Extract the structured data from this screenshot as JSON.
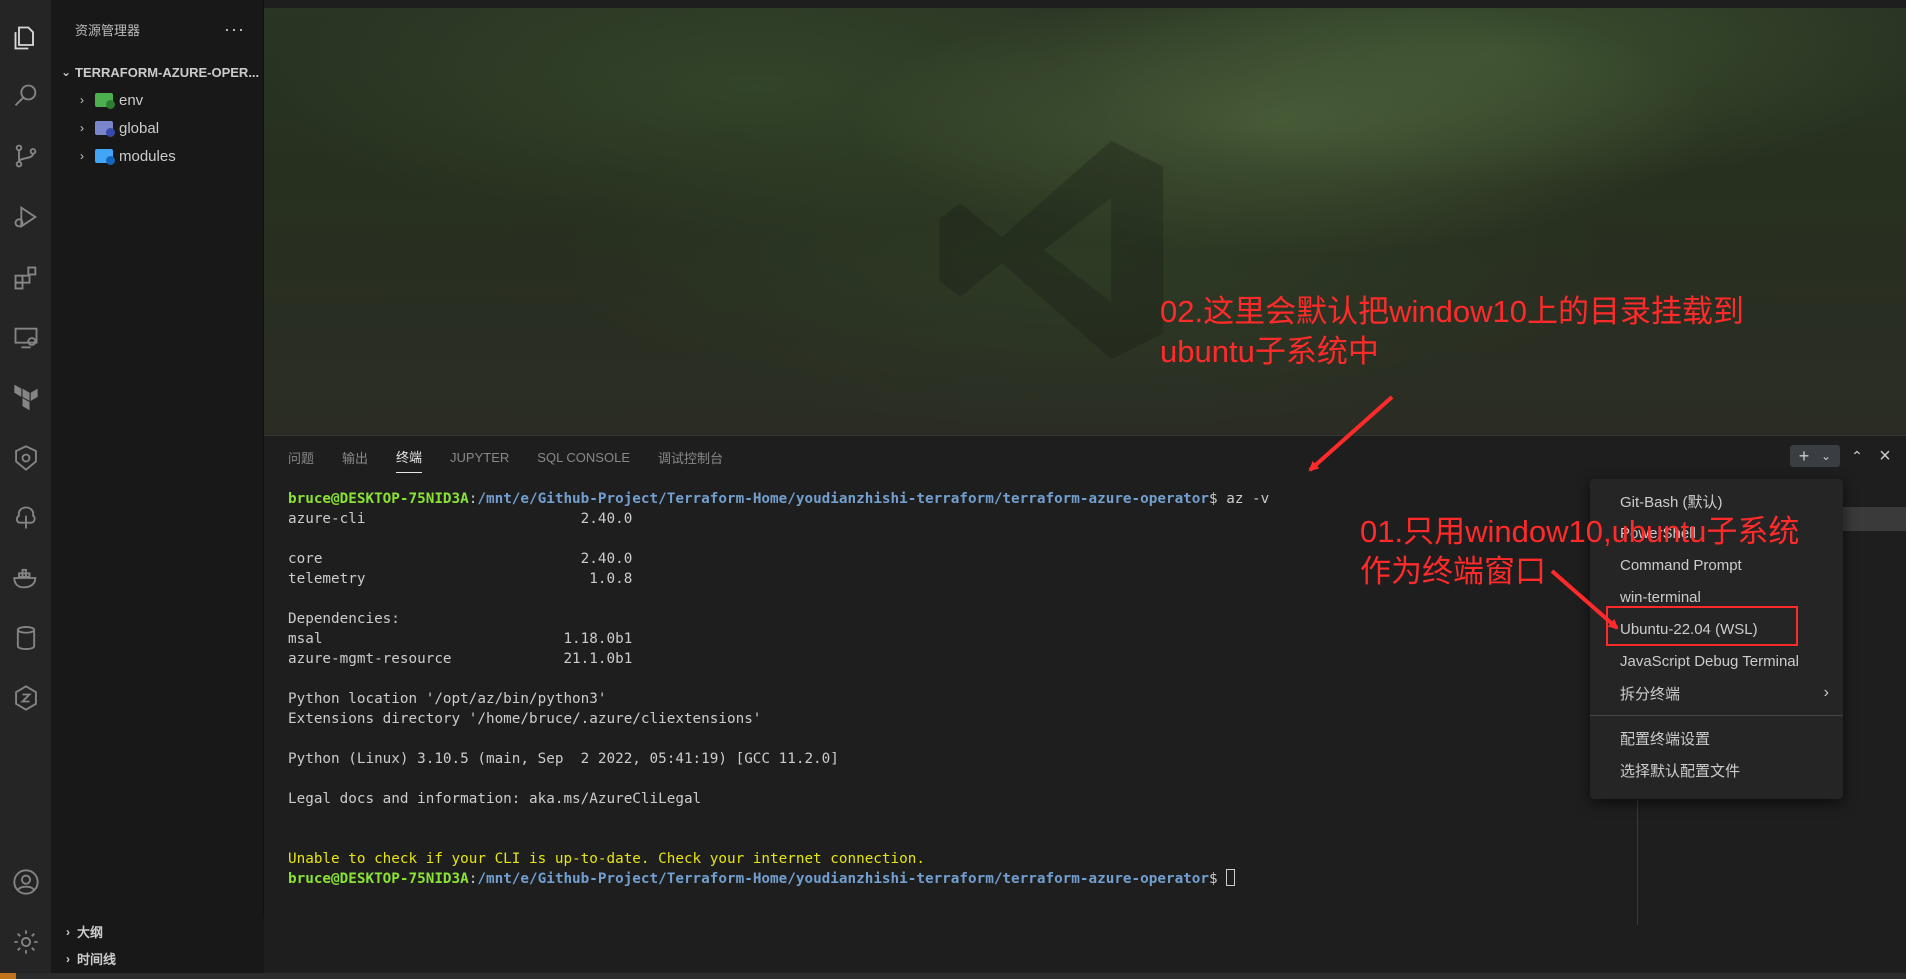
{
  "sidebar": {
    "header": "资源管理器",
    "more": "···",
    "project": "TERRAFORM-AZURE-OPER...",
    "items": [
      {
        "label": "env"
      },
      {
        "label": "global"
      },
      {
        "label": "modules"
      }
    ],
    "outline": "大纲",
    "timeline": "时间线"
  },
  "activity_icons": [
    "explorer-icon",
    "search-icon",
    "source-control-icon",
    "run-debug-icon",
    "extensions-icon",
    "remote-explorer-icon",
    "terraform-icon",
    "kubernetes-icon",
    "azure-icon",
    "docker-icon",
    "database-icon",
    "extension-z-icon",
    "account-icon",
    "settings-icon"
  ],
  "panel": {
    "tabs": [
      "问题",
      "输出",
      "终端",
      "JUPYTER",
      "SQL CONSOLE",
      "调试控制台"
    ],
    "active_tab": "终端"
  },
  "terminal": {
    "user": "bruce@DESKTOP-75NID3A",
    "path": "/mnt/e/Github-Project/Terraform-Home/youdianzhishi-terraform/terraform-azure-operator",
    "command": "$ az -v",
    "lines": [
      "azure-cli                         2.40.0",
      "",
      "core                              2.40.0",
      "telemetry                          1.0.8",
      "",
      "Dependencies:",
      "msal                            1.18.0b1",
      "azure-mgmt-resource             21.1.0b1",
      "",
      "Python location '/opt/az/bin/python3'",
      "Extensions directory '/home/bruce/.azure/cliextensions'",
      "",
      "Python (Linux) 3.10.5 (main, Sep  2 2022, 05:41:19) [GCC 11.2.0]",
      "",
      "Legal docs and information: aka.ms/AzureCliLegal",
      "",
      ""
    ],
    "warning": "Unable to check if your CLI is up-to-date. Check your internet connection.",
    "prompt_end": "$ "
  },
  "menu": {
    "items": [
      "Git-Bash (默认)",
      "PowerShell",
      "Command Prompt",
      "win-terminal",
      "Ubuntu-22.04 (WSL)",
      "JavaScript Debug Terminal",
      "拆分终端"
    ],
    "items2": [
      "配置终端设置",
      "选择默认配置文件"
    ],
    "selected": "Ubuntu-22.04 (WSL)"
  },
  "annotations": {
    "a02_line1": "02.这里会默认把window10上的目录挂载到",
    "a02_line2": "ubuntu子系统中",
    "a01_line1": "01.只用window10,ubuntu子系统",
    "a01_line2": "作为终端窗口",
    "color": "#ff2a2a"
  }
}
